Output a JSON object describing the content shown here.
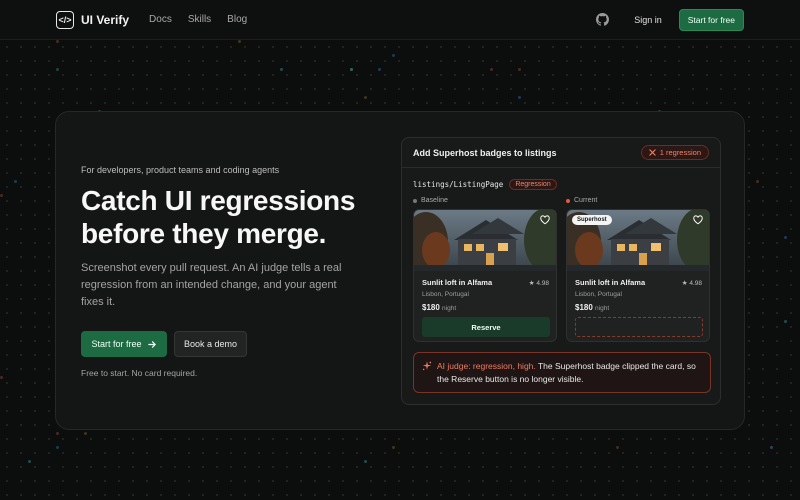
{
  "nav": {
    "brand": "UI Verify",
    "logo_glyph": "</>",
    "links": [
      "Docs",
      "Skills",
      "Blog"
    ],
    "github_icon": "github-icon",
    "sign_in": "Sign in",
    "cta": "Start for free"
  },
  "hero": {
    "eyebrow": "For developers, product teams and coding agents",
    "headline": "Catch UI regressions before they merge.",
    "subtext": "Screenshot every pull request. An AI judge tells a real regression from an intended change, and your agent fixes it.",
    "primary_cta": "Start for free",
    "primary_cta_icon": "arrow-right-icon",
    "secondary_cta": "Book a demo",
    "footnote": "Free to start. No card required."
  },
  "panel": {
    "title": "Add Superhost badges to listings",
    "regression_count": "1 regression",
    "path": "listings/ListingPage",
    "path_badge": "Regression",
    "baseline_label": "Baseline",
    "current_label": "Current",
    "baseline_card": {
      "title": "Sunlit loft in Alfama",
      "rating": "4.98",
      "location": "Lisbon, Portugal",
      "price": "$180",
      "price_unit": "night",
      "button": "Reserve"
    },
    "current_card": {
      "badge": "Superhost",
      "title": "Sunlit loft in Alfama",
      "rating": "4.98",
      "location": "Lisbon, Portugal",
      "price": "$180",
      "price_unit": "night"
    },
    "judge": {
      "verdict": "AI judge: regression, high.",
      "message": "The Superhost badge clipped the card, so the Reserve button is no longer visible."
    }
  },
  "colors": {
    "accent_green": "#1d6b43",
    "regression_red": "#f0836b",
    "background": "#0c0d0d"
  }
}
